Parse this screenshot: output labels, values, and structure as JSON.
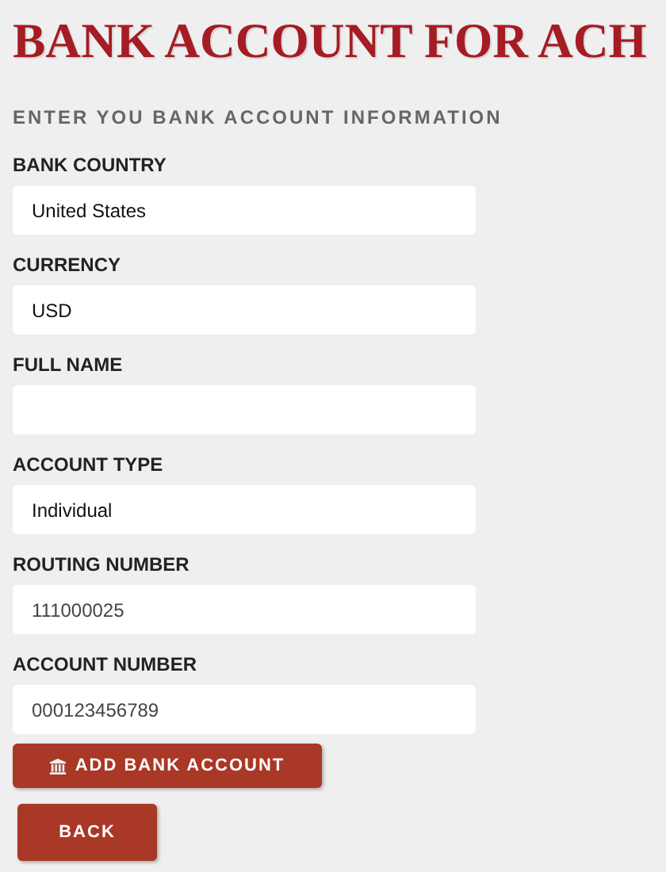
{
  "title": "BANK ACCOUNT FOR ACH",
  "subtitle": "ENTER YOU BANK ACCOUNT INFORMATION",
  "fields": [
    {
      "label": "BANK COUNTRY",
      "kind": "select",
      "value": "United States"
    },
    {
      "label": "CURRENCY",
      "kind": "select",
      "value": "USD"
    },
    {
      "label": "FULL NAME",
      "kind": "text"
    },
    {
      "label": "ACCOUNT TYPE",
      "kind": "select",
      "value": "Individual"
    },
    {
      "label": "ROUTING NUMBER",
      "kind": "text",
      "value": "111000025"
    },
    {
      "label": "ACCOUNT NUMBER",
      "kind": "text",
      "value": "000123456789"
    }
  ],
  "add_button": "ADD BANK ACCOUNT",
  "back_button": "BACK"
}
